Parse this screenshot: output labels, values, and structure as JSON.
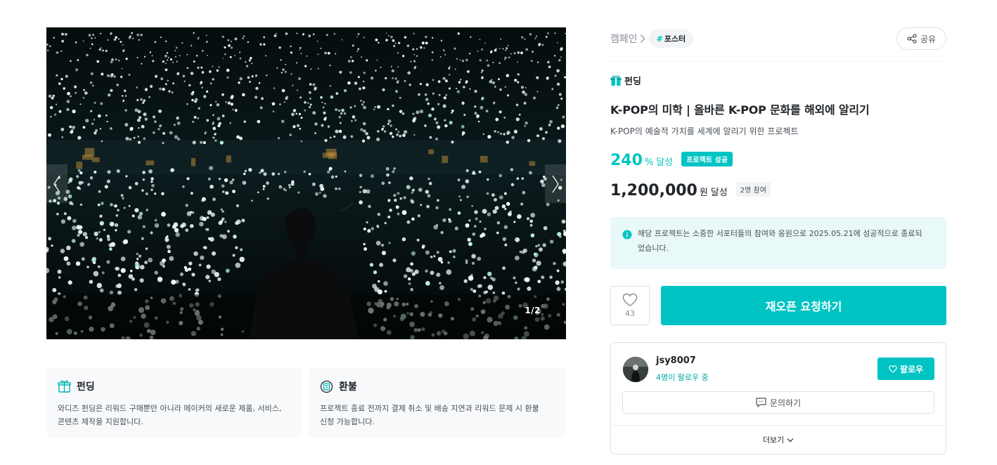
{
  "hero": {
    "counter": "1/2",
    "prev_icon": "chevron-left-icon",
    "next_icon": "chevron-right-icon"
  },
  "info_cards": [
    {
      "icon": "gift-icon",
      "title": "펀딩",
      "desc": "와디즈 펀딩은 리워드 구매뿐만 아니라 메이커의 새로운 제품, 서비스,\n콘텐츠 제작을 지원합니다."
    },
    {
      "icon": "refund-icon",
      "title": "환불",
      "desc": "프로젝트 종료 전까지 결제 취소 및 배송 지연과 리워드 문제 시 환불\n신청 가능합니다."
    }
  ],
  "breadcrumb": {
    "category": "캠페인",
    "tag_hash": "#",
    "tag": "포스터"
  },
  "share": {
    "label": "공유",
    "icon": "share-icon"
  },
  "project": {
    "type_icon": "gift-icon",
    "type": "펀딩",
    "title": "K-POP의 미학 | 올바른 K-POP 문화를 해외에 알리기",
    "subtitle": "K-POP의 예술적 가치를 세계에 알리기 위한 프로젝트",
    "rate": "240",
    "rate_unit": "%",
    "rate_word": "달성",
    "success_badge": "프로젝트 성공",
    "amount": "1,200,000",
    "amount_unit": "원",
    "amount_word": "달성",
    "participants": "2명 참여"
  },
  "notice": {
    "icon": "info-icon",
    "text": "해당 프로젝트는 소중한 서포터들의 참여와 응원으로 2025.05.21에 성공적으로 종료되었습니다."
  },
  "actions": {
    "like_count": "43",
    "reopen_label": "재오픈 요청하기"
  },
  "maker": {
    "name": "jsy8007",
    "followers": "4명이 팔로우 중",
    "follow_label": "팔로우",
    "inquiry_label": "문의하기",
    "more_label": "더보기"
  },
  "colors": {
    "accent": "#00c4c4",
    "notice_bg": "#e9f8f8",
    "text": "#212529",
    "muted": "#868e96"
  }
}
